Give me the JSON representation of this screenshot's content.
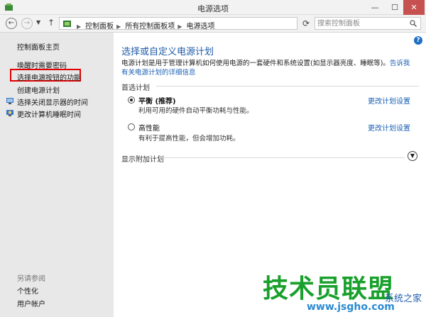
{
  "window": {
    "title": "电源选项"
  },
  "address": {
    "breadcrumbs": [
      "控制面板",
      "所有控制面板项",
      "电源选项"
    ],
    "search_placeholder": "搜索控制面板"
  },
  "sidebar": {
    "items": [
      {
        "label": "控制面板主页"
      },
      {
        "label": "唤醒时需要密码"
      },
      {
        "label": "选择电源按钮的功能"
      },
      {
        "label": "创建电源计划"
      },
      {
        "label": "选择关闭显示器的时间"
      },
      {
        "label": "更改计算机睡眠时间"
      }
    ],
    "see_also_title": "另请参阅",
    "see_also": [
      {
        "label": "个性化"
      },
      {
        "label": "用户帐户"
      }
    ]
  },
  "main": {
    "title": "选择或自定义电源计划",
    "description": "电源计划是用于管理计算机如何使用电源的一套硬件和系统设置(如显示器亮度、睡眠等)。",
    "description_link": "告诉我有关电源计划的详细信息",
    "preferred_label": "首选计划",
    "plans": [
      {
        "name": "平衡 (推荐)",
        "desc": "利用可用的硬件自动平衡功耗与性能。",
        "link": "更改计划设置",
        "selected": true
      },
      {
        "name": "高性能",
        "desc": "有利于提高性能，但会增加功耗。",
        "link": "更改计划设置",
        "selected": false
      }
    ],
    "more_plans_label": "显示附加计划"
  },
  "watermark": {
    "brand": "技术员联盟",
    "url": "www.jsgho.com",
    "side": "系统之家"
  }
}
